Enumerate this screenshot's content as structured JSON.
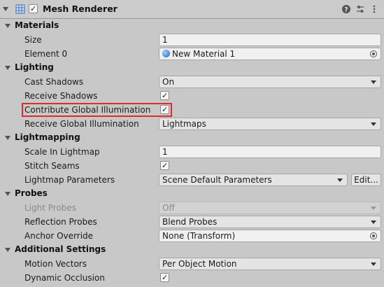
{
  "component": {
    "title": "Mesh Renderer",
    "enabled": true
  },
  "sections": {
    "materials": "Materials",
    "lighting": "Lighting",
    "lightmapping": "Lightmapping",
    "probes": "Probes",
    "additional": "Additional Settings"
  },
  "materials": {
    "size_label": "Size",
    "size_value": "1",
    "element0_label": "Element 0",
    "element0_value": "New Material 1"
  },
  "lighting": {
    "cast_shadows_label": "Cast Shadows",
    "cast_shadows_value": "On",
    "receive_shadows_label": "Receive Shadows",
    "receive_shadows_checked": true,
    "contribute_gi_label": "Contribute Global Illumination",
    "contribute_gi_checked": true,
    "receive_gi_label": "Receive Global Illumination",
    "receive_gi_value": "Lightmaps"
  },
  "lightmapping": {
    "scale_label": "Scale In Lightmap",
    "scale_value": "1",
    "stitch_label": "Stitch Seams",
    "stitch_checked": true,
    "params_label": "Lightmap Parameters",
    "params_value": "Scene Default Parameters",
    "edit_label": "Edit..."
  },
  "probes": {
    "light_probes_label": "Light Probes",
    "light_probes_value": "Off",
    "reflection_label": "Reflection Probes",
    "reflection_value": "Blend Probes",
    "anchor_label": "Anchor Override",
    "anchor_value": "None (Transform)"
  },
  "additional": {
    "motion_label": "Motion Vectors",
    "motion_value": "Per Object Motion",
    "occlusion_label": "Dynamic Occlusion",
    "occlusion_checked": true
  },
  "glyphs": {
    "check": "✓"
  },
  "colors": {
    "highlight": "#e02b2b",
    "panel_bg": "#c8c8c8",
    "material_icon": "#1f5fb8"
  },
  "icons": {
    "component": "mesh-renderer-icon",
    "help": "help-icon",
    "presets": "presets-icon",
    "menu": "kebab-menu-icon"
  }
}
